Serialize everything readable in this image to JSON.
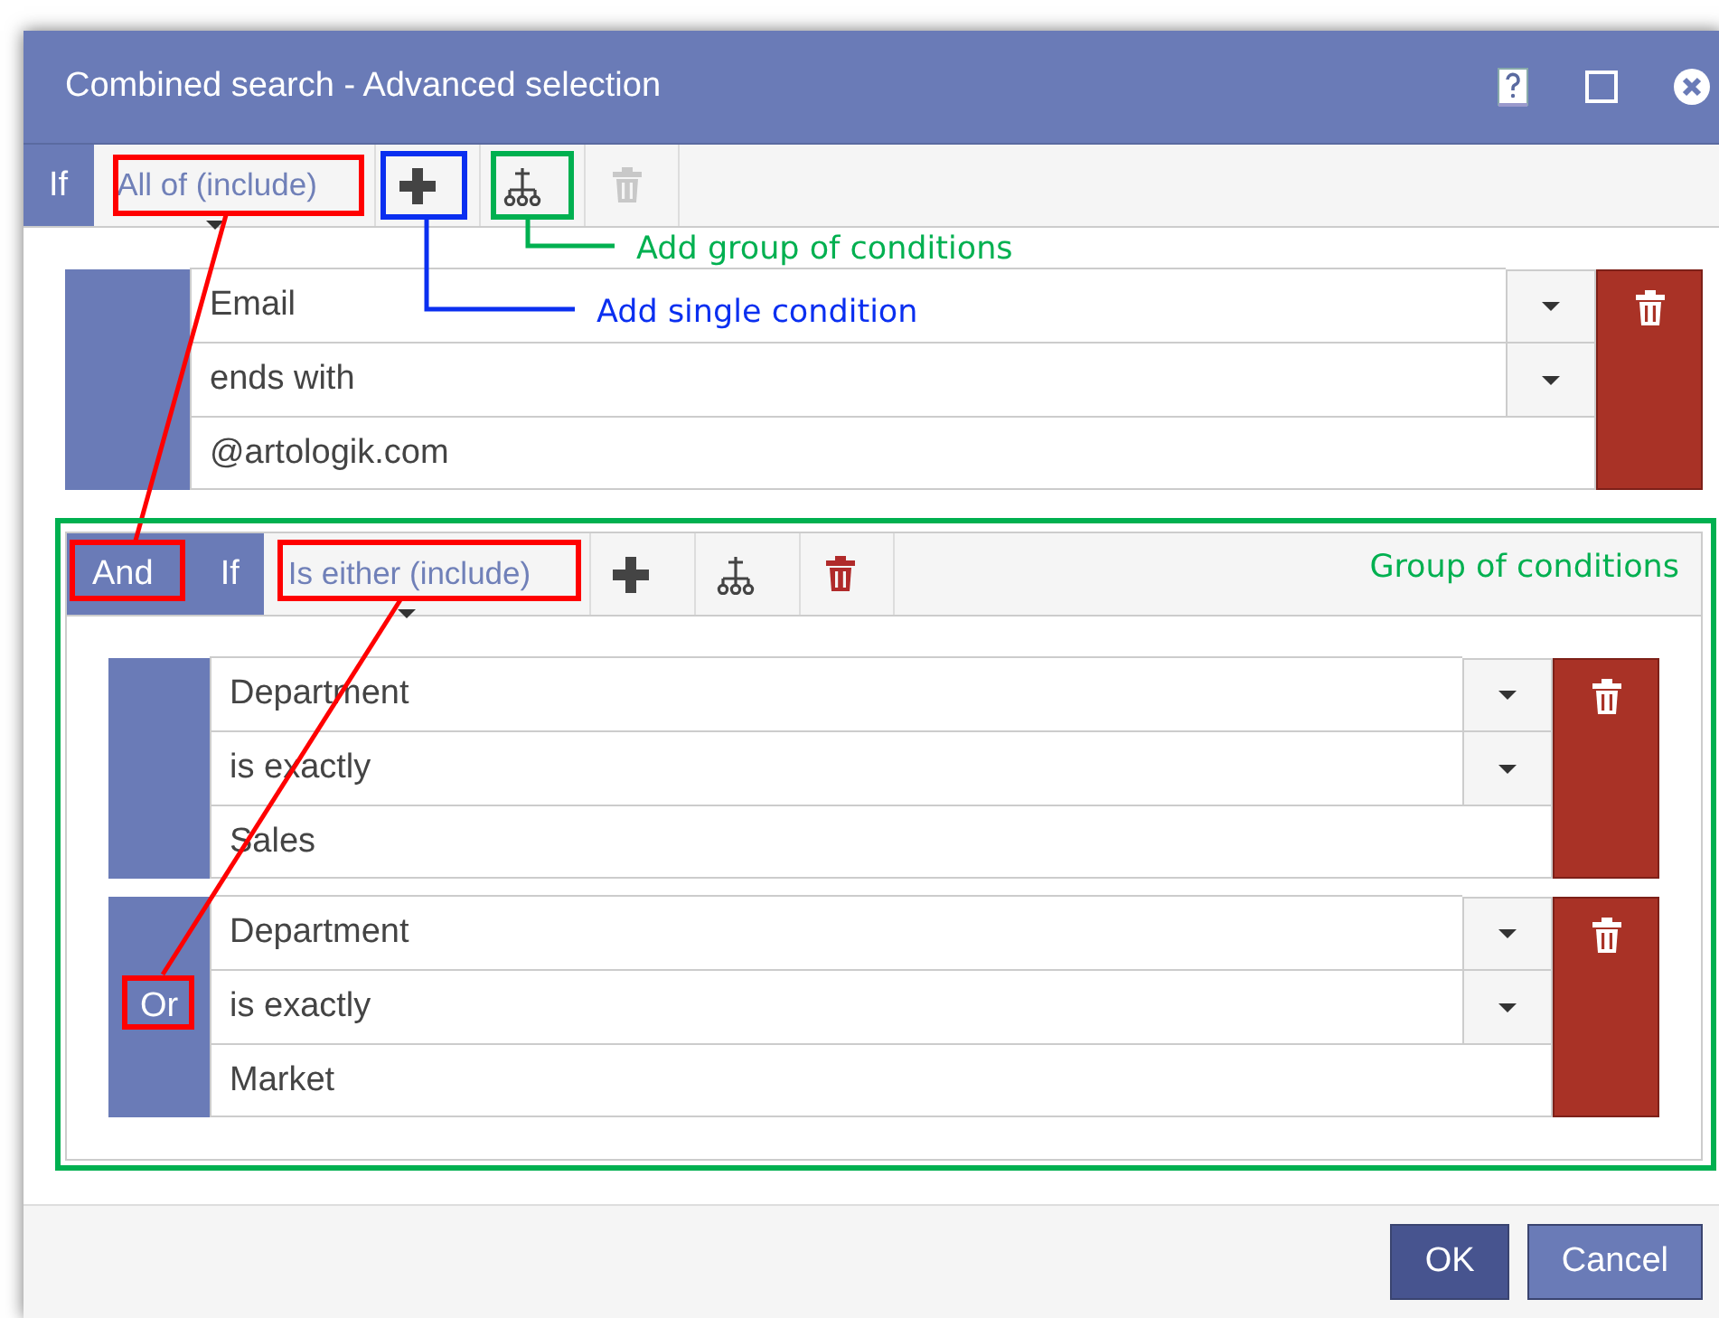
{
  "window": {
    "title": "Combined search - Advanced selection"
  },
  "toolbar": {
    "if_label": "If",
    "mode": "All of (include)",
    "delete_disabled": true
  },
  "items": [
    {
      "kind": "condition",
      "field": "Email",
      "operator": "ends with",
      "value": "@artologik.com"
    },
    {
      "kind": "group",
      "connector": "And",
      "if_label": "If",
      "mode": "Is either (include)",
      "delete_disabled": false,
      "conditions": [
        {
          "kind": "condition",
          "field": "Department",
          "operator": "is exactly",
          "value": "Sales"
        },
        {
          "kind": "condition",
          "connector": "Or",
          "field": "Department",
          "operator": "is exactly",
          "value": "Market"
        }
      ]
    }
  ],
  "buttons": [
    {
      "label": "OK",
      "kind": "primary"
    },
    {
      "label": "Cancel",
      "kind": "secondary"
    }
  ],
  "annotations": [
    {
      "text": "Add group of conditions",
      "color": "#00b050"
    },
    {
      "text": "Add single condition",
      "color": "#0a2ff0"
    },
    {
      "text": "Group of conditions",
      "color": "#00b050"
    }
  ]
}
